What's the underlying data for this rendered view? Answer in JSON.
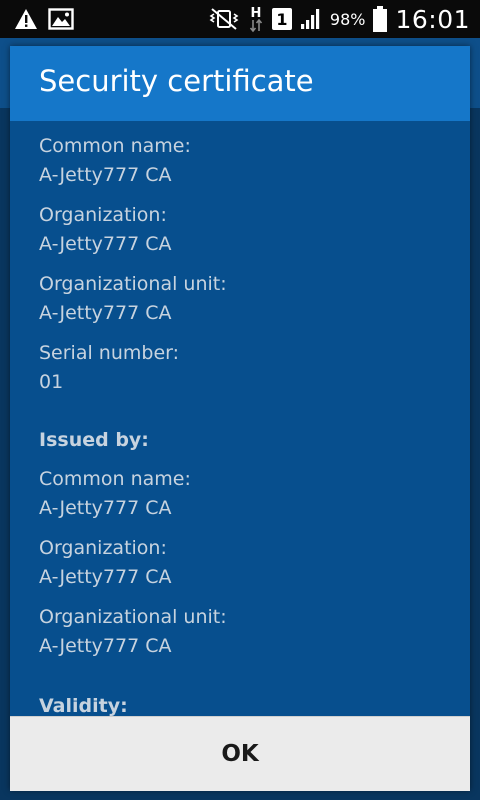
{
  "status_bar": {
    "left_icons": [
      "warning-icon",
      "image-icon"
    ],
    "right_icons": [
      "mute-vibrate-icon",
      "h-data-icon",
      "sim-1-icon",
      "signal-icon",
      "battery-icon"
    ],
    "sim_label": "1",
    "network_type": "H",
    "battery_percent": "98%",
    "time": "16:01"
  },
  "dialog": {
    "title": "Security certificate",
    "subject": {
      "common_name_label": "Common name:",
      "common_name_value": "A-Jetty777 CA",
      "organization_label": "Organization:",
      "organization_value": "A-Jetty777 CA",
      "org_unit_label": "Organizational unit:",
      "org_unit_value": "A-Jetty777 CA",
      "serial_label": "Serial number:",
      "serial_value": "01"
    },
    "issued_by": {
      "heading": "Issued by:",
      "common_name_label": "Common name:",
      "common_name_value": "A-Jetty777 CA",
      "organization_label": "Organization:",
      "organization_value": "A-Jetty777 CA",
      "org_unit_label": "Organizational unit:",
      "org_unit_value": "A-Jetty777 CA"
    },
    "validity_heading": "Validity:",
    "ok_label": "OK"
  },
  "colors": {
    "dialog_header": "#1577c9",
    "dialog_body": "#074f8e",
    "footer": "#ebebeb"
  }
}
